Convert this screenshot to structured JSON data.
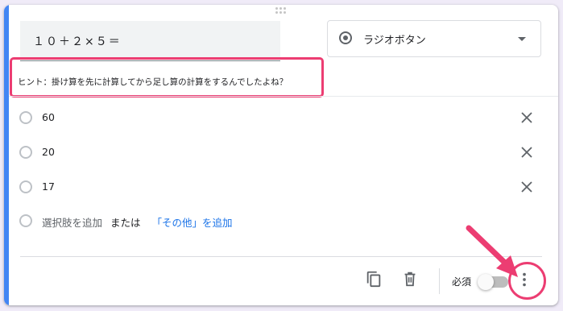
{
  "question": {
    "title": "１０＋２×５＝",
    "hint": "ヒント：掛け算を先に計算してから足し算の計算をするんでしたよね？"
  },
  "question_type": {
    "selected": "ラジオボタン",
    "icon": "radio-button-checked-icon"
  },
  "options": [
    {
      "label": "60"
    },
    {
      "label": "20"
    },
    {
      "label": "17"
    }
  ],
  "add_option": {
    "label": "選択肢を追加",
    "or": "または",
    "other": "「その他」を追加"
  },
  "footer": {
    "copy_icon": "content-copy-icon",
    "delete_icon": "trash-icon",
    "required_label": "必須",
    "required_on": false,
    "more_icon": "more-vert-icon"
  },
  "annotation": {
    "color": "#ec3d72"
  },
  "colors": {
    "accent": "#4285f4",
    "link": "#1a73e8",
    "background": "#f0ebf8"
  }
}
